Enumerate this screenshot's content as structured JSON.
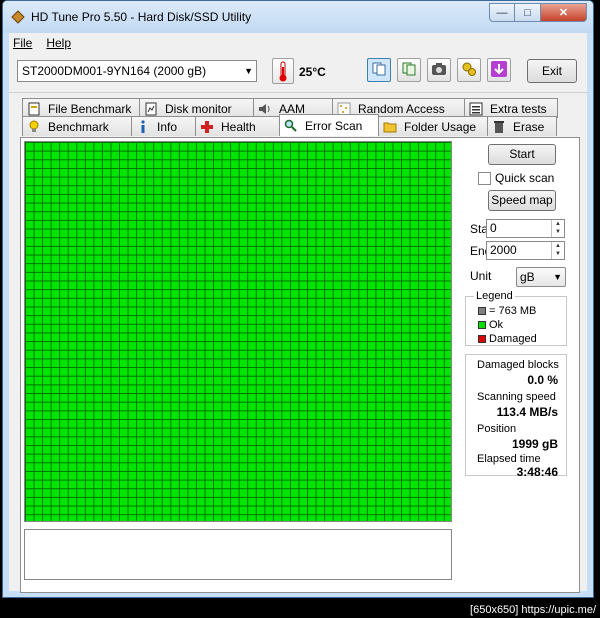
{
  "window": {
    "title": "HD Tune Pro 5.50 - Hard Disk/SSD Utility"
  },
  "menu": [
    {
      "label": "File"
    },
    {
      "label": "Help"
    }
  ],
  "toolbar": {
    "drive": "ST2000DM001-9YN164 (2000 gB)",
    "temperature": "25°C",
    "exit_label": "Exit",
    "icons": [
      "copy-text-icon",
      "copy-screenshot-icon",
      "camera-icon",
      "options-icon",
      "save-icon"
    ]
  },
  "tabs": {
    "row1": [
      {
        "label": "File Benchmark",
        "icon": "file-benchmark-icon"
      },
      {
        "label": "Disk monitor",
        "icon": "disk-monitor-icon"
      },
      {
        "label": "AAM",
        "icon": "speaker-icon"
      },
      {
        "label": "Random Access",
        "icon": "random-access-icon"
      },
      {
        "label": "Extra tests",
        "icon": "extra-tests-icon"
      }
    ],
    "row2": [
      {
        "label": "Benchmark",
        "icon": "bulb-icon"
      },
      {
        "label": "Info",
        "icon": "info-icon"
      },
      {
        "label": "Health",
        "icon": "health-cross-icon"
      },
      {
        "label": "Error Scan",
        "icon": "magnifier-icon"
      },
      {
        "label": "Folder Usage",
        "icon": "folder-icon"
      },
      {
        "label": "Erase",
        "icon": "trash-icon"
      }
    ],
    "selected": "Error Scan"
  },
  "scan": {
    "start_button": "Start",
    "quick_scan_label": "Quick scan",
    "quick_scan_checked": false,
    "speed_map_button": "Speed map",
    "start_label": "Start",
    "start_value": "0",
    "end_label": "End",
    "end_value": "2000",
    "unit_label": "Unit",
    "unit_value": "gB"
  },
  "legend": {
    "title": "Legend",
    "items": [
      {
        "label": "= 763 MB",
        "color": "#808080"
      },
      {
        "label": "Ok",
        "color": "#00dd00"
      },
      {
        "label": "Damaged",
        "color": "#dd0000"
      }
    ]
  },
  "stats": {
    "damaged_blocks_label": "Damaged blocks",
    "damaged_blocks_value": "0.0 %",
    "scanning_speed_label": "Scanning speed",
    "scanning_speed_value": "113.4 MB/s",
    "position_label": "Position",
    "position_value": "1999 gB",
    "elapsed_label": "Elapsed time",
    "elapsed_value": "3:48:46"
  },
  "footer": {
    "text": "[650x650] https://upic.me/"
  },
  "colors": {
    "ok_block": "#00e600",
    "grid_line": "#007000",
    "window_frame": "#c7dff6"
  }
}
